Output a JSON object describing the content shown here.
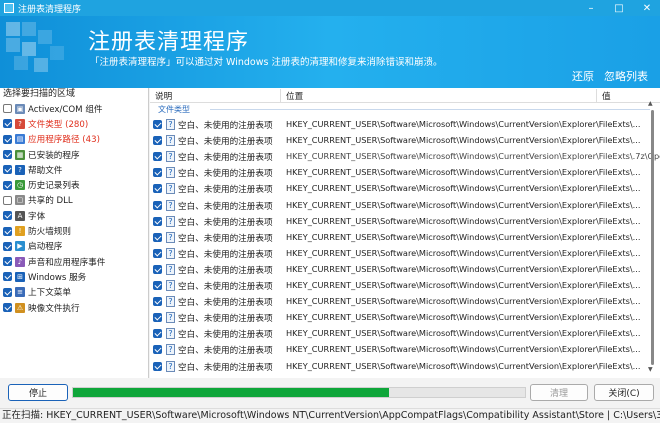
{
  "window": {
    "title": "注册表清理程序",
    "controls": [
      "–",
      "□",
      "✕"
    ]
  },
  "header": {
    "title": "注册表清理程序",
    "subtitle": "「注册表清理程序」可以通过对 Windows 注册表的清理和修复来消除错误和崩溃。",
    "links": [
      "还原",
      "忽略列表"
    ]
  },
  "left_panel": {
    "title": "选择要扫描的区域",
    "items": [
      {
        "label": "Activex/COM 组件",
        "checked": false,
        "icon": "component-icon",
        "red": false
      },
      {
        "label": "文件类型 (280)",
        "checked": true,
        "icon": "file-type-icon",
        "red": true
      },
      {
        "label": "应用程序路径 (43)",
        "checked": true,
        "icon": "app-path-icon",
        "red": true
      },
      {
        "label": "已安装的程序",
        "checked": true,
        "icon": "installed-programs-icon",
        "red": false
      },
      {
        "label": "帮助文件",
        "checked": true,
        "icon": "help-icon",
        "red": false
      },
      {
        "label": "历史记录列表",
        "checked": true,
        "icon": "history-icon",
        "red": false
      },
      {
        "label": "共享的 DLL",
        "checked": false,
        "icon": "dll-icon",
        "red": false
      },
      {
        "label": "字体",
        "checked": true,
        "icon": "font-icon",
        "red": false
      },
      {
        "label": "防火墙规则",
        "checked": true,
        "icon": "firewall-icon",
        "red": false
      },
      {
        "label": "启动程序",
        "checked": true,
        "icon": "startup-icon",
        "red": false
      },
      {
        "label": "声音和应用程序事件",
        "checked": true,
        "icon": "sound-icon",
        "red": false
      },
      {
        "label": "Windows 服务",
        "checked": true,
        "icon": "windows-service-icon",
        "red": false
      },
      {
        "label": "上下文菜单",
        "checked": true,
        "icon": "context-menu-icon",
        "red": false
      },
      {
        "label": "映像文件执行",
        "checked": true,
        "icon": "image-exec-icon",
        "red": false
      }
    ]
  },
  "table": {
    "columns": [
      "说明",
      "位置",
      "值"
    ],
    "group": "文件类型",
    "rows": [
      {
        "desc": "空白、未使用的注册表项",
        "loc": "HKEY_CURRENT_USER\\Software\\Microsoft\\Windows\\CurrentVersion\\Explorer\\FileExts\\..."
      },
      {
        "desc": "空白、未使用的注册表项",
        "loc": "HKEY_CURRENT_USER\\Software\\Microsoft\\Windows\\CurrentVersion\\Explorer\\FileExts\\..."
      },
      {
        "desc": "空白、未使用的注册表项",
        "loc": "HKEY_CURRENT_USER\\Software\\Microsoft\\Windows\\CurrentVersion\\Explorer\\FileExts\\.7z\\OpenWithList"
      },
      {
        "desc": "空白、未使用的注册表项",
        "loc": "HKEY_CURRENT_USER\\Software\\Microsoft\\Windows\\CurrentVersion\\Explorer\\FileExts\\..."
      },
      {
        "desc": "空白、未使用的注册表项",
        "loc": "HKEY_CURRENT_USER\\Software\\Microsoft\\Windows\\CurrentVersion\\Explorer\\FileExts\\..."
      },
      {
        "desc": "空白、未使用的注册表项",
        "loc": "HKEY_CURRENT_USER\\Software\\Microsoft\\Windows\\CurrentVersion\\Explorer\\FileExts\\..."
      },
      {
        "desc": "空白、未使用的注册表项",
        "loc": "HKEY_CURRENT_USER\\Software\\Microsoft\\Windows\\CurrentVersion\\Explorer\\FileExts\\..."
      },
      {
        "desc": "空白、未使用的注册表项",
        "loc": "HKEY_CURRENT_USER\\Software\\Microsoft\\Windows\\CurrentVersion\\Explorer\\FileExts\\..."
      },
      {
        "desc": "空白、未使用的注册表项",
        "loc": "HKEY_CURRENT_USER\\Software\\Microsoft\\Windows\\CurrentVersion\\Explorer\\FileExts\\..."
      },
      {
        "desc": "空白、未使用的注册表项",
        "loc": "HKEY_CURRENT_USER\\Software\\Microsoft\\Windows\\CurrentVersion\\Explorer\\FileExts\\..."
      },
      {
        "desc": "空白、未使用的注册表项",
        "loc": "HKEY_CURRENT_USER\\Software\\Microsoft\\Windows\\CurrentVersion\\Explorer\\FileExts\\..."
      },
      {
        "desc": "空白、未使用的注册表项",
        "loc": "HKEY_CURRENT_USER\\Software\\Microsoft\\Windows\\CurrentVersion\\Explorer\\FileExts\\..."
      },
      {
        "desc": "空白、未使用的注册表项",
        "loc": "HKEY_CURRENT_USER\\Software\\Microsoft\\Windows\\CurrentVersion\\Explorer\\FileExts\\..."
      },
      {
        "desc": "空白、未使用的注册表项",
        "loc": "HKEY_CURRENT_USER\\Software\\Microsoft\\Windows\\CurrentVersion\\Explorer\\FileExts\\..."
      },
      {
        "desc": "空白、未使用的注册表项",
        "loc": "HKEY_CURRENT_USER\\Software\\Microsoft\\Windows\\CurrentVersion\\Explorer\\FileExts\\..."
      },
      {
        "desc": "空白、未使用的注册表项",
        "loc": "HKEY_CURRENT_USER\\Software\\Microsoft\\Windows\\CurrentVersion\\Explorer\\FileExts\\..."
      }
    ]
  },
  "footer": {
    "stop_label": "停止",
    "clean_label": "清理",
    "close_label": "关闭(C)",
    "progress": 0.7
  },
  "status": {
    "text": "正在扫描: HKEY_CURRENT_USER\\Software\\Microsoft\\Windows NT\\CurrentVersion\\AppCompatFlags\\Compatibility Assistant\\Store | C:\\Users\\36036\\AppData\\Local\\Pro"
  },
  "colors": {
    "accent": "#1fa3e0",
    "progress": "#0fa63a",
    "checkbox": "#1a62b8",
    "warning_text": "#e0301e"
  }
}
